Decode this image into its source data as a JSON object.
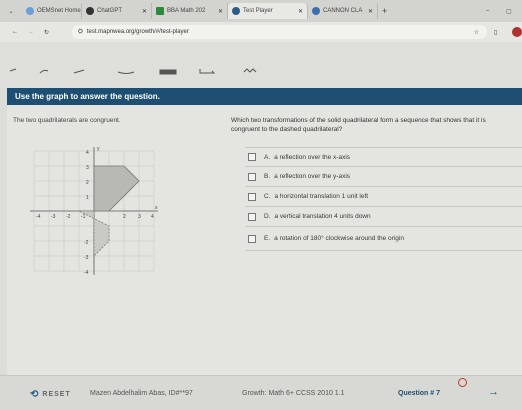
{
  "browser": {
    "tabs": [
      {
        "label": "OEMSnet Home",
        "color": "#6aa0d8"
      },
      {
        "label": "ChatGPT",
        "color": "#333333"
      },
      {
        "label": "BBA Math 202",
        "color": "#2b8a3e"
      },
      {
        "label": "Test Player",
        "color": "#2a5c8a"
      },
      {
        "label": "CANNON CLA",
        "color": "#3b6fb0"
      }
    ],
    "url": "test.mapnwea.org/growth/#/test-player"
  },
  "question": {
    "header": "Use the graph to answer the question.",
    "left_text": "The two quadrilaterals are congruent.",
    "prompt": "Which two transformations of the solid quadrilateral form a sequence that shows that it is congruent to the dashed quadrilateral?",
    "choices": [
      {
        "letter": "A.",
        "text": "a reflection over the x-axis"
      },
      {
        "letter": "B.",
        "text": "a reflection over the y-axis"
      },
      {
        "letter": "C.",
        "text": "a horizontal translation 1 unit left"
      },
      {
        "letter": "D.",
        "text": "a vertical translation 4 units down"
      },
      {
        "letter": "E.",
        "text": "a rotation of 180° clockwise around the origin"
      }
    ]
  },
  "graph": {
    "x_ticks": [
      "-4",
      "-3",
      "-2",
      "-1",
      "2",
      "3",
      "4"
    ],
    "y_ticks": [
      "4",
      "3",
      "2",
      "1",
      "-2",
      "-3",
      "-4"
    ],
    "x_label": "x",
    "y_label": "y"
  },
  "footer": {
    "reset": "RESET",
    "student": "Mazen Abdelhalim Abas, ID#**97",
    "test": "Growth: Math 6+ CCSS 2010 1.1",
    "question_number": "Question # 7"
  }
}
